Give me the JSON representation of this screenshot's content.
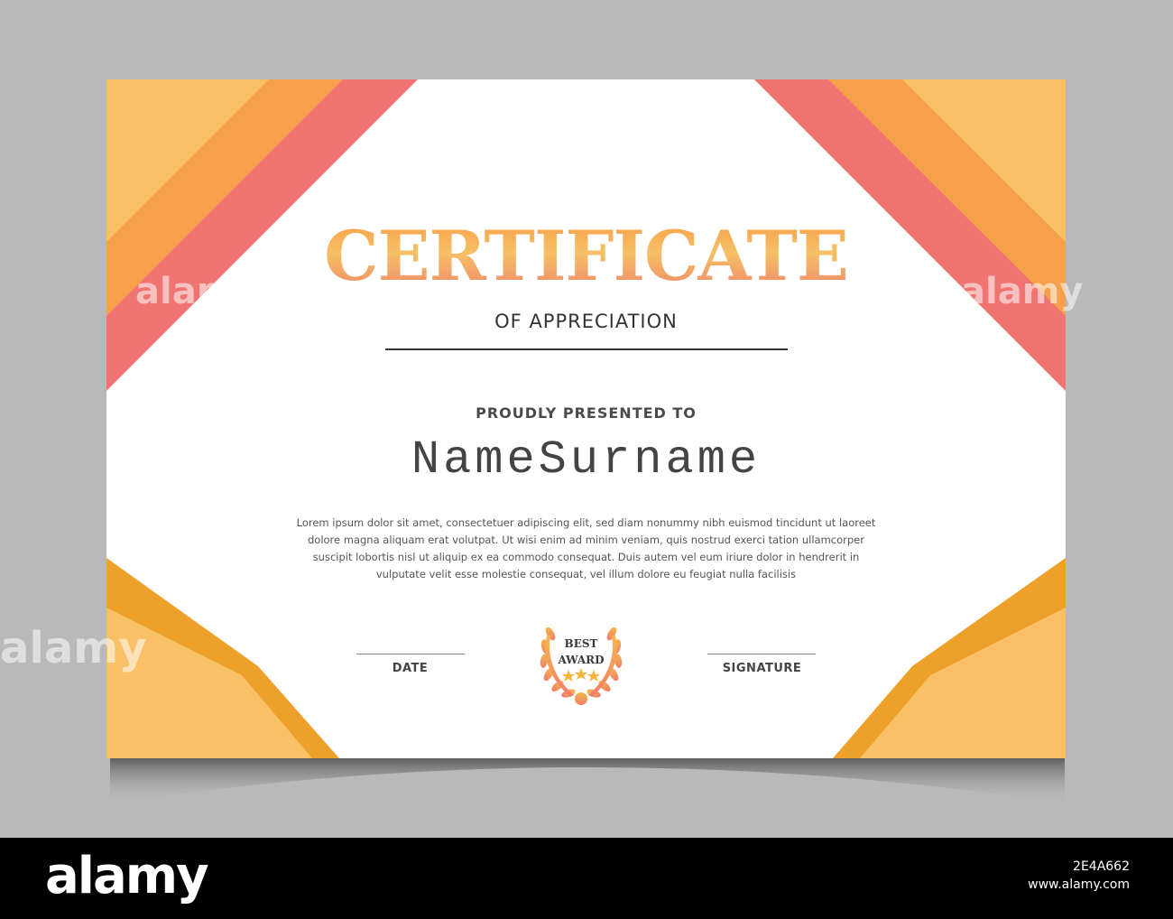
{
  "certificate": {
    "title": "CERTIFICATE",
    "subtitle": "OF APPRECIATION",
    "presented_label": "PROUDLY PRESENTED TO",
    "recipient_name": "NameSurname",
    "body": "Lorem ipsum dolor sit amet, consectetuer adipiscing elit, sed diam nonummy nibh euismod tincidunt ut laoreet dolore magna aliquam erat volutpat. Ut wisi enim ad minim veniam, quis nostrud exerci tation ullamcorper suscipit lobortis nisl ut aliquip ex ea commodo consequat. Duis autem vel eum iriure dolor in hendrerit in vulputate velit esse molestie consequat, vel illum dolore eu feugiat nulla facilisis",
    "date_label": "DATE",
    "signature_label": "SIGNATURE",
    "badge": {
      "line1": "BEST",
      "line2": "AWARD"
    }
  },
  "colors": {
    "light_orange": "#f9c065",
    "orange": "#f7a04b",
    "coral": "#f07472",
    "dark_orange": "#eda02a",
    "background": "#b9b9b9"
  },
  "watermark": {
    "text": "alamy"
  },
  "footer": {
    "logo": "alamy",
    "image_id": "2E4A662",
    "site": "www.alamy.com"
  }
}
